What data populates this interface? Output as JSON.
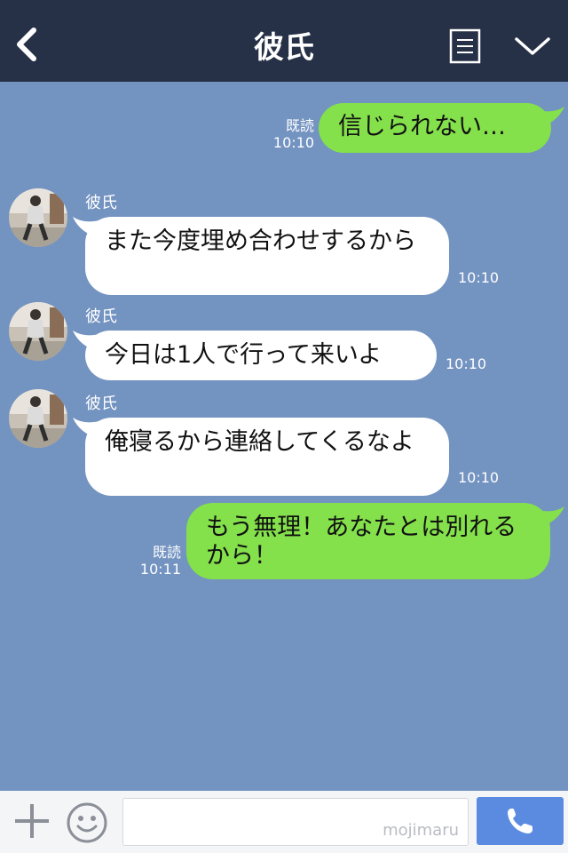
{
  "header": {
    "title": "彼氏",
    "back_icon": "chevron-left-icon",
    "notes_icon": "notes-list-icon",
    "menu_icon": "chevron-down-icon"
  },
  "messages": [
    {
      "from": "me",
      "text": "信じられない…",
      "read": "既読",
      "time": "10:10"
    },
    {
      "from": "彼氏",
      "text": "また今度埋め合わせするから",
      "time": "10:10"
    },
    {
      "from": "彼氏",
      "text": "今日は1人で行って来いよ",
      "time": "10:10"
    },
    {
      "from": "彼氏",
      "text": "俺寝るから連絡してくるなよ",
      "time": "10:10"
    },
    {
      "from": "me",
      "text": "もう無理！あなたとは別れるから！",
      "read": "既読",
      "time": "10:11"
    }
  ],
  "footer": {
    "input_value": "",
    "watermark": "mojimaru",
    "plus_icon": "plus-icon",
    "emoji_icon": "emoji-icon",
    "call_icon": "phone-icon"
  },
  "colors": {
    "header_bg": "#263147",
    "chat_bg": "#7393c1",
    "my_bubble": "#84e04b",
    "their_bubble": "#ffffff",
    "call_button": "#5a8be0"
  }
}
